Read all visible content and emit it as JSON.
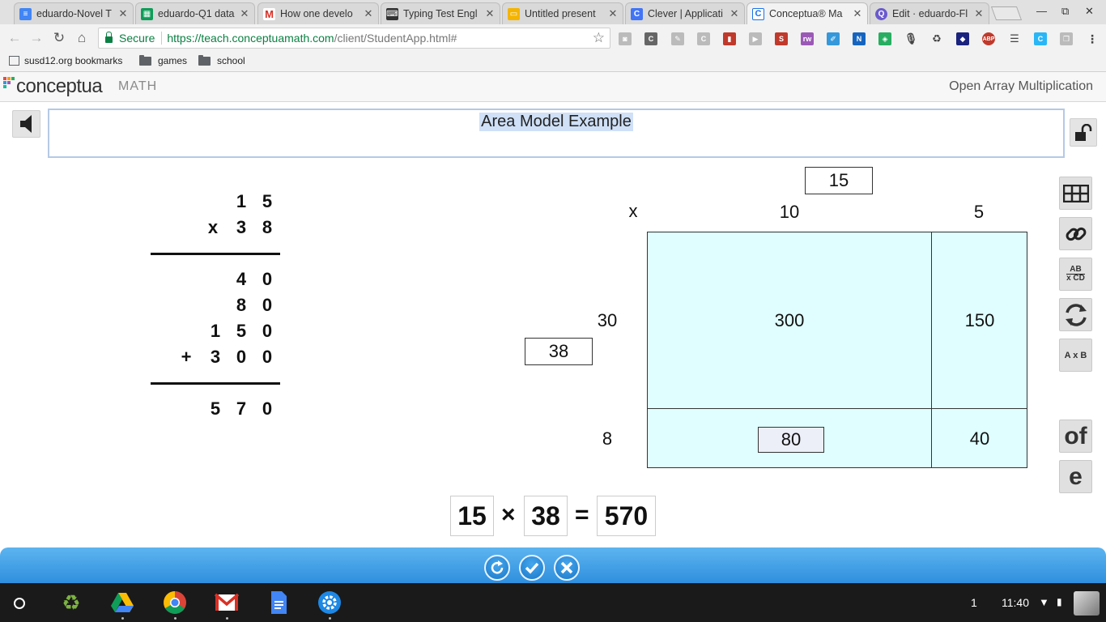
{
  "browser": {
    "tabs": [
      {
        "title": "eduardo-Novel T",
        "favicon": "docs-icon",
        "color": "#4285f4"
      },
      {
        "title": "eduardo-Q1 data",
        "favicon": "sheets-icon",
        "color": "#0f9d58"
      },
      {
        "title": "How one develo",
        "favicon": "gmail-icon",
        "color": "#d93025"
      },
      {
        "title": "Typing Test Engl",
        "favicon": "typing-icon",
        "color": "#333333"
      },
      {
        "title": "Untitled present",
        "favicon": "slides-icon",
        "color": "#f4b400"
      },
      {
        "title": "Clever | Applicati",
        "favicon": "clever-icon",
        "color": "#4274f6"
      },
      {
        "title": "Conceptua® Ma",
        "favicon": "conceptua-icon",
        "color": "#1a73e8"
      },
      {
        "title": "Edit · eduardo-Fl",
        "favicon": "quizizz-icon",
        "color": "#6a5acd"
      }
    ],
    "address": {
      "secure_label": "Secure",
      "url_host": "https://teach.conceptuamath.com",
      "url_path": "/client/StudentApp.html#"
    },
    "bookmarks": [
      {
        "label": "susd12.org bookmarks"
      },
      {
        "label": "games"
      },
      {
        "label": "school"
      }
    ]
  },
  "app": {
    "logo_word": "conceptua",
    "logo_math": "MATH",
    "title": "Open Array Multiplication",
    "prompt": "Area Model Example"
  },
  "vertical": {
    "multiplicand": [
      "1",
      "5"
    ],
    "multiplier_sign": "x",
    "multiplier": [
      "3",
      "8"
    ],
    "partials": [
      [
        "",
        "",
        "4",
        "0"
      ],
      [
        "",
        "",
        "8",
        "0"
      ],
      [
        "",
        "1",
        "5",
        "0"
      ],
      [
        "+",
        "3",
        "0",
        "0"
      ]
    ],
    "result": [
      "5",
      "7",
      "0"
    ]
  },
  "area_model": {
    "top_factor": "15",
    "times_symbol": "x",
    "col_labels": [
      "10",
      "5"
    ],
    "left_factor": "38",
    "row_labels": [
      "30",
      "8"
    ],
    "cells": {
      "r1c1": "300",
      "r1c2": "150",
      "r2c1": "80",
      "r2c2": "40"
    },
    "fill_color": "#e0feff"
  },
  "equation": {
    "a": "15",
    "op": "×",
    "b": "38",
    "eq": "=",
    "result": "570"
  },
  "tools": {
    "grid": "grid-icon",
    "link": "link-icon",
    "abcd_top": "AB",
    "abcd_bottom": "x CD",
    "refresh": "refresh-icon",
    "axb_label": "A x B",
    "of_label": "of",
    "e_label": "e"
  },
  "shelf": {
    "notification_count": "1",
    "time": "11:40"
  }
}
